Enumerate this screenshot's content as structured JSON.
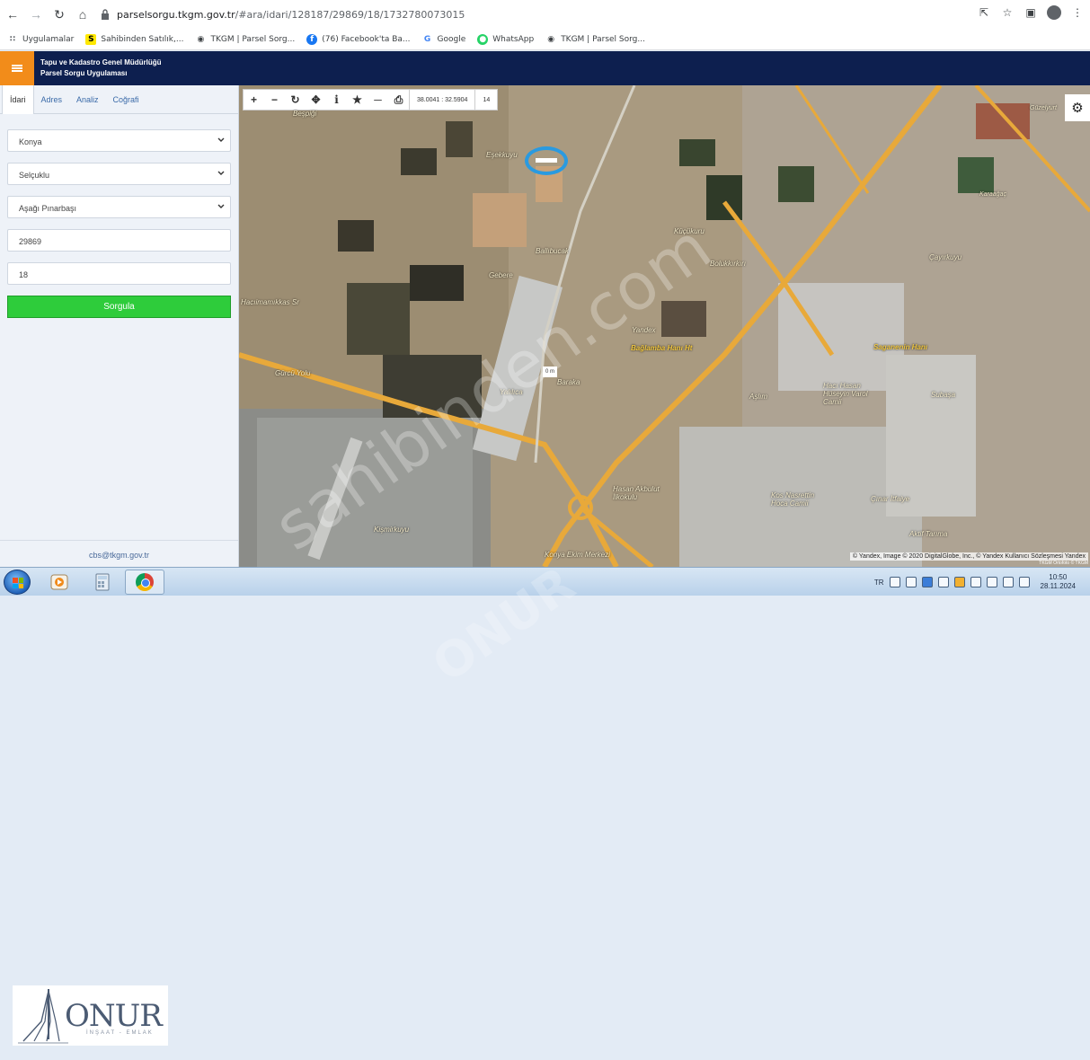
{
  "browser": {
    "url_host": "parselsorgu.tkgm.gov.tr",
    "url_path": "/#ara/idari/128187/29869/18/1732780073015"
  },
  "bookmarks": [
    {
      "label": "Uygulamalar",
      "icon": "apps-grid-icon"
    },
    {
      "label": "Sahibinden Satılık,...",
      "icon": "sahibinden-icon"
    },
    {
      "label": "TKGM | Parsel Sorg...",
      "icon": "map-pin-icon"
    },
    {
      "label": "(76) Facebook'ta Ba...",
      "icon": "facebook-icon"
    },
    {
      "label": "Google",
      "icon": "google-icon"
    },
    {
      "label": "WhatsApp",
      "icon": "whatsapp-icon"
    },
    {
      "label": "TKGM | Parsel Sorg...",
      "icon": "map-pin-icon"
    }
  ],
  "app": {
    "title_line1": "Tapu ve Kadastro Genel Müdürlüğü",
    "title_line2": "Parsel Sorgu Uygulaması",
    "accent": "#f28c1a",
    "header_color": "#0d1f4f"
  },
  "sidebar": {
    "tabs": [
      "İdari",
      "Adres",
      "Analiz",
      "Coğrafi"
    ],
    "province": "Konya",
    "district": "Selçuklu",
    "neighborhood": "Aşağı Pınarbaşı",
    "block": "29869",
    "parcel": "18",
    "query_button": "Sorgula",
    "query_color": "#2ecc3b",
    "footer_email": "cbs@tkgm.gov.tr"
  },
  "map": {
    "coordinates": "38.0041 : 32.5904",
    "zoom": "14",
    "scale_label": "0 m",
    "places": [
      "Beşpiği",
      "Eşekkuyu",
      "Ballıbucak",
      "Gebere",
      "Hacıimamıkkas Sr",
      "Yalılıca",
      "Bağlamba Hanı Ht",
      "Bolukkırkırı",
      "Çayırkuyu",
      "Yandex",
      "Saganenin Hanı",
      "Hacı Hasan Hüseyin Varol Camii",
      "Subaşa",
      "Aşlım",
      "Kişmirkuyu",
      "Hasan Akbulut İlkokulu",
      "Kos Nasrettin Hoca Camii",
      "Çınar İtfaiye",
      "Aktif Tarıma",
      "Konya Ekim Merkezi",
      "Karaağaç",
      "Güzelyurt",
      "Küçükuru",
      "Gürcü Yolu",
      "Baraka"
    ],
    "attribution": "© Yandex, Image © 2020 DigitalGlobe, Inc., © Yandex Kullanıcı Sözleşmesi Yandex",
    "attribution2": "TKGM Ortofoto © TKGM"
  },
  "taskbar": {
    "lang": "TR",
    "time": "10:50",
    "date": "28.11.2024"
  },
  "watermark": {
    "line1": "sahibinden.com",
    "line2": "ONUR"
  },
  "logo": {
    "name": "ONUR",
    "sub": "İNŞAAT - EMLAK"
  }
}
